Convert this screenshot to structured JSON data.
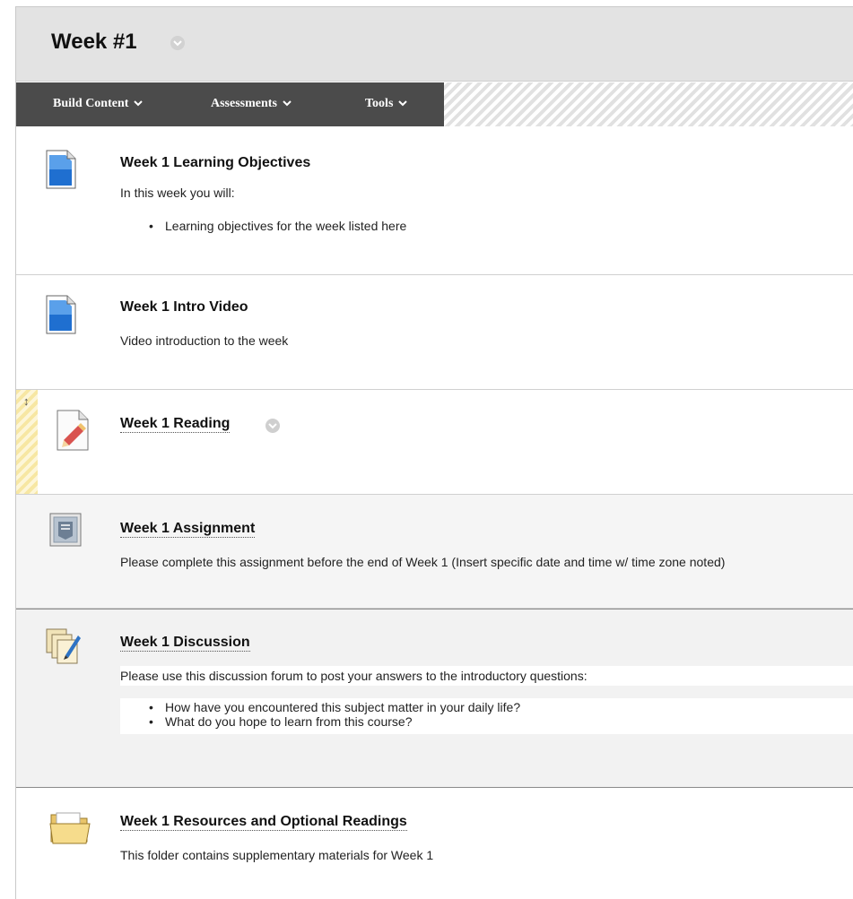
{
  "header": {
    "title": "Week #1"
  },
  "toolbar": {
    "menus": [
      {
        "label": "Build Content"
      },
      {
        "label": "Assessments"
      },
      {
        "label": "Tools"
      }
    ]
  },
  "items": [
    {
      "title": "Week 1 Learning Objectives",
      "description": "In this week you will:",
      "bullets": [
        "Learning objectives for the week listed here"
      ],
      "icon": "document-icon"
    },
    {
      "title": "Week 1 Intro Video",
      "description": "Video introduction to the week",
      "icon": "document-icon"
    },
    {
      "title": "Week 1 Reading",
      "icon": "reading-tool-icon"
    },
    {
      "title": "Week 1 Assignment",
      "description": "Please complete this assignment before the end of Week 1 (Insert specific date and time w/ time zone noted)",
      "icon": "assignment-icon"
    },
    {
      "title": "Week 1 Discussion",
      "description": "Please use this discussion forum to post your answers to the introductory questions:",
      "bullets": [
        "How have you encountered this subject matter in your daily life?",
        "What do you hope to learn from this course?"
      ],
      "icon": "discussion-icon"
    },
    {
      "title": "Week 1 Resources and Optional Readings",
      "description": "This folder contains supplementary materials for Week 1",
      "icon": "folder-icon"
    }
  ],
  "colors": {
    "toolbar_bg": "#4b4b4b",
    "header_bg": "#e3e3e3",
    "doc_blue": "#1f6fd0"
  }
}
